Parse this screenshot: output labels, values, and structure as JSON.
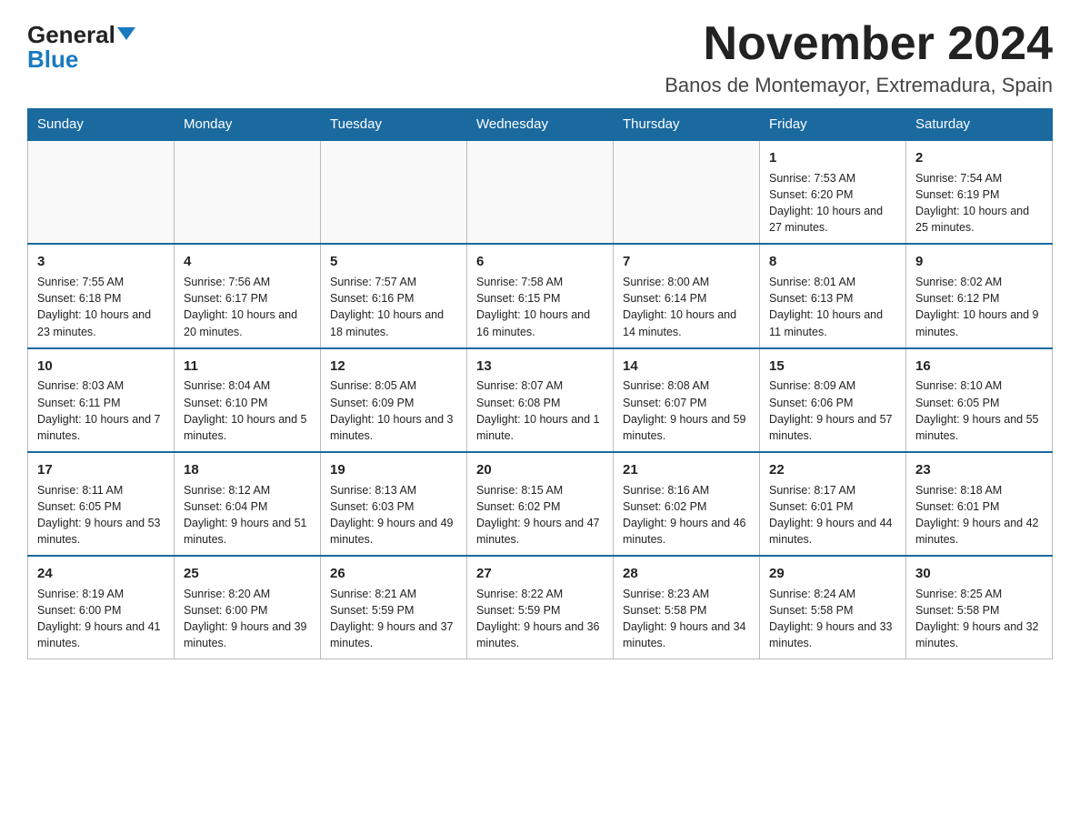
{
  "header": {
    "logo_general": "General",
    "logo_blue": "Blue",
    "month_title": "November 2024",
    "location": "Banos de Montemayor, Extremadura, Spain"
  },
  "days_of_week": [
    "Sunday",
    "Monday",
    "Tuesday",
    "Wednesday",
    "Thursday",
    "Friday",
    "Saturday"
  ],
  "weeks": [
    [
      {
        "day": "",
        "sunrise": "",
        "sunset": "",
        "daylight": "",
        "empty": true
      },
      {
        "day": "",
        "sunrise": "",
        "sunset": "",
        "daylight": "",
        "empty": true
      },
      {
        "day": "",
        "sunrise": "",
        "sunset": "",
        "daylight": "",
        "empty": true
      },
      {
        "day": "",
        "sunrise": "",
        "sunset": "",
        "daylight": "",
        "empty": true
      },
      {
        "day": "",
        "sunrise": "",
        "sunset": "",
        "daylight": "",
        "empty": true
      },
      {
        "day": "1",
        "sunrise": "Sunrise: 7:53 AM",
        "sunset": "Sunset: 6:20 PM",
        "daylight": "Daylight: 10 hours and 27 minutes.",
        "empty": false
      },
      {
        "day": "2",
        "sunrise": "Sunrise: 7:54 AM",
        "sunset": "Sunset: 6:19 PM",
        "daylight": "Daylight: 10 hours and 25 minutes.",
        "empty": false
      }
    ],
    [
      {
        "day": "3",
        "sunrise": "Sunrise: 7:55 AM",
        "sunset": "Sunset: 6:18 PM",
        "daylight": "Daylight: 10 hours and 23 minutes.",
        "empty": false
      },
      {
        "day": "4",
        "sunrise": "Sunrise: 7:56 AM",
        "sunset": "Sunset: 6:17 PM",
        "daylight": "Daylight: 10 hours and 20 minutes.",
        "empty": false
      },
      {
        "day": "5",
        "sunrise": "Sunrise: 7:57 AM",
        "sunset": "Sunset: 6:16 PM",
        "daylight": "Daylight: 10 hours and 18 minutes.",
        "empty": false
      },
      {
        "day": "6",
        "sunrise": "Sunrise: 7:58 AM",
        "sunset": "Sunset: 6:15 PM",
        "daylight": "Daylight: 10 hours and 16 minutes.",
        "empty": false
      },
      {
        "day": "7",
        "sunrise": "Sunrise: 8:00 AM",
        "sunset": "Sunset: 6:14 PM",
        "daylight": "Daylight: 10 hours and 14 minutes.",
        "empty": false
      },
      {
        "day": "8",
        "sunrise": "Sunrise: 8:01 AM",
        "sunset": "Sunset: 6:13 PM",
        "daylight": "Daylight: 10 hours and 11 minutes.",
        "empty": false
      },
      {
        "day": "9",
        "sunrise": "Sunrise: 8:02 AM",
        "sunset": "Sunset: 6:12 PM",
        "daylight": "Daylight: 10 hours and 9 minutes.",
        "empty": false
      }
    ],
    [
      {
        "day": "10",
        "sunrise": "Sunrise: 8:03 AM",
        "sunset": "Sunset: 6:11 PM",
        "daylight": "Daylight: 10 hours and 7 minutes.",
        "empty": false
      },
      {
        "day": "11",
        "sunrise": "Sunrise: 8:04 AM",
        "sunset": "Sunset: 6:10 PM",
        "daylight": "Daylight: 10 hours and 5 minutes.",
        "empty": false
      },
      {
        "day": "12",
        "sunrise": "Sunrise: 8:05 AM",
        "sunset": "Sunset: 6:09 PM",
        "daylight": "Daylight: 10 hours and 3 minutes.",
        "empty": false
      },
      {
        "day": "13",
        "sunrise": "Sunrise: 8:07 AM",
        "sunset": "Sunset: 6:08 PM",
        "daylight": "Daylight: 10 hours and 1 minute.",
        "empty": false
      },
      {
        "day": "14",
        "sunrise": "Sunrise: 8:08 AM",
        "sunset": "Sunset: 6:07 PM",
        "daylight": "Daylight: 9 hours and 59 minutes.",
        "empty": false
      },
      {
        "day": "15",
        "sunrise": "Sunrise: 8:09 AM",
        "sunset": "Sunset: 6:06 PM",
        "daylight": "Daylight: 9 hours and 57 minutes.",
        "empty": false
      },
      {
        "day": "16",
        "sunrise": "Sunrise: 8:10 AM",
        "sunset": "Sunset: 6:05 PM",
        "daylight": "Daylight: 9 hours and 55 minutes.",
        "empty": false
      }
    ],
    [
      {
        "day": "17",
        "sunrise": "Sunrise: 8:11 AM",
        "sunset": "Sunset: 6:05 PM",
        "daylight": "Daylight: 9 hours and 53 minutes.",
        "empty": false
      },
      {
        "day": "18",
        "sunrise": "Sunrise: 8:12 AM",
        "sunset": "Sunset: 6:04 PM",
        "daylight": "Daylight: 9 hours and 51 minutes.",
        "empty": false
      },
      {
        "day": "19",
        "sunrise": "Sunrise: 8:13 AM",
        "sunset": "Sunset: 6:03 PM",
        "daylight": "Daylight: 9 hours and 49 minutes.",
        "empty": false
      },
      {
        "day": "20",
        "sunrise": "Sunrise: 8:15 AM",
        "sunset": "Sunset: 6:02 PM",
        "daylight": "Daylight: 9 hours and 47 minutes.",
        "empty": false
      },
      {
        "day": "21",
        "sunrise": "Sunrise: 8:16 AM",
        "sunset": "Sunset: 6:02 PM",
        "daylight": "Daylight: 9 hours and 46 minutes.",
        "empty": false
      },
      {
        "day": "22",
        "sunrise": "Sunrise: 8:17 AM",
        "sunset": "Sunset: 6:01 PM",
        "daylight": "Daylight: 9 hours and 44 minutes.",
        "empty": false
      },
      {
        "day": "23",
        "sunrise": "Sunrise: 8:18 AM",
        "sunset": "Sunset: 6:01 PM",
        "daylight": "Daylight: 9 hours and 42 minutes.",
        "empty": false
      }
    ],
    [
      {
        "day": "24",
        "sunrise": "Sunrise: 8:19 AM",
        "sunset": "Sunset: 6:00 PM",
        "daylight": "Daylight: 9 hours and 41 minutes.",
        "empty": false
      },
      {
        "day": "25",
        "sunrise": "Sunrise: 8:20 AM",
        "sunset": "Sunset: 6:00 PM",
        "daylight": "Daylight: 9 hours and 39 minutes.",
        "empty": false
      },
      {
        "day": "26",
        "sunrise": "Sunrise: 8:21 AM",
        "sunset": "Sunset: 5:59 PM",
        "daylight": "Daylight: 9 hours and 37 minutes.",
        "empty": false
      },
      {
        "day": "27",
        "sunrise": "Sunrise: 8:22 AM",
        "sunset": "Sunset: 5:59 PM",
        "daylight": "Daylight: 9 hours and 36 minutes.",
        "empty": false
      },
      {
        "day": "28",
        "sunrise": "Sunrise: 8:23 AM",
        "sunset": "Sunset: 5:58 PM",
        "daylight": "Daylight: 9 hours and 34 minutes.",
        "empty": false
      },
      {
        "day": "29",
        "sunrise": "Sunrise: 8:24 AM",
        "sunset": "Sunset: 5:58 PM",
        "daylight": "Daylight: 9 hours and 33 minutes.",
        "empty": false
      },
      {
        "day": "30",
        "sunrise": "Sunrise: 8:25 AM",
        "sunset": "Sunset: 5:58 PM",
        "daylight": "Daylight: 9 hours and 32 minutes.",
        "empty": false
      }
    ]
  ]
}
